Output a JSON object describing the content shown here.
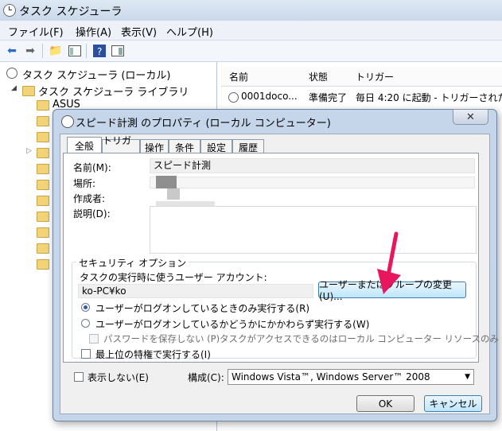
{
  "window": {
    "title": "タスク スケジューラ"
  },
  "menu": [
    "ファイル(F)",
    "操作(A)",
    "表示(V)",
    "ヘルプ(H)"
  ],
  "tree": {
    "root": "タスク スケジューラ (ローカル)",
    "library": "タスク スケジューラ ライブラリ",
    "first_folder": "ASUS"
  },
  "list": {
    "columns": [
      "名前",
      "状態",
      "トリガー"
    ],
    "rows": [
      {
        "name": "0001doco...",
        "status": "準備完了",
        "trigger": "毎日 4:20 に起動 - トリガーされた"
      }
    ]
  },
  "dialog": {
    "title": "スピード計測 のプロパティ (ローカル コンピューター)",
    "close": "✕",
    "tabs": [
      "全般",
      "トリガー",
      "操作",
      "条件",
      "設定",
      "履歴"
    ],
    "name_label": "名前(M):",
    "name_value": "スピード計測",
    "location_label": "場所:",
    "author_label": "作成者:",
    "description_label": "説明(D):",
    "security_title": "セキュリティ オプション",
    "run_as_label": "タスクの実行時に使うユーザー アカウント:",
    "run_as_value": "ko-PC¥ko",
    "change_user_button": "ユーザーまたはグループの変更(U)...",
    "radio_logged_on": "ユーザーがログオンしているときのみ実行する(R)",
    "radio_whether": "ユーザーがログオンしているかどうかにかかわらず実行する(W)",
    "no_store_password": "パスワードを保存しない (P)タスクがアクセスできるのはローカル コンピューター リソースのみ",
    "highest_privileges": "最上位の特権で実行する(I)",
    "hidden_label": "表示しない(E)",
    "configure_label": "構成(C):",
    "configure_value": "Windows Vista™, Windows Server™ 2008",
    "ok_button": "OK",
    "cancel_button": "キャンセル"
  },
  "colors": {
    "annotation_arrow": "#e8175d"
  }
}
